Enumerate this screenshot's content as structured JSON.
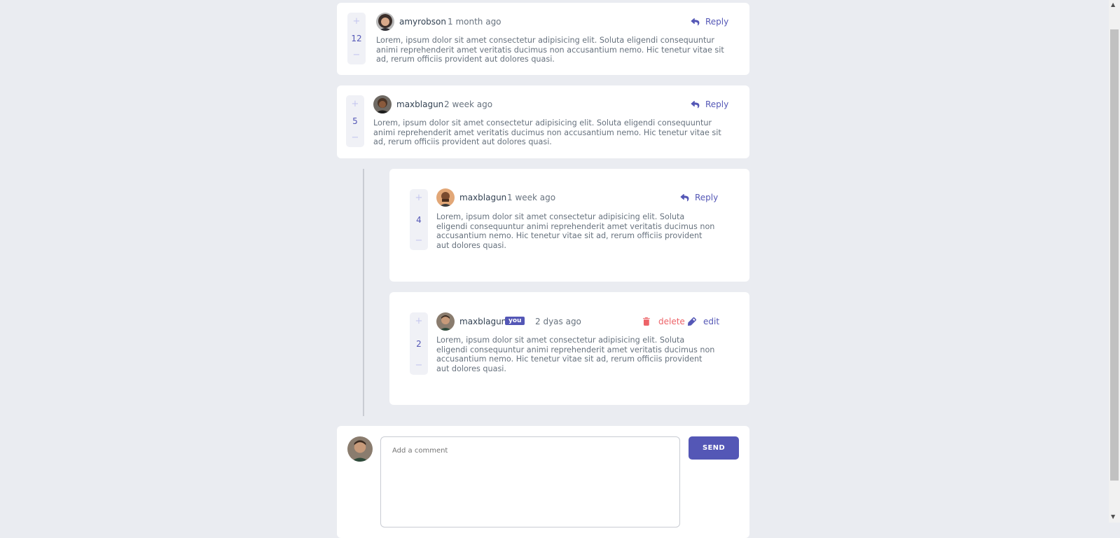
{
  "comments": [
    {
      "score": "12",
      "username": "amyrobson",
      "time": "1 month ago",
      "reply": "Reply",
      "text": "Lorem, ipsum dolor sit amet consectetur adipisicing elit. Soluta eligendi consequuntur animi reprehenderit amet veritatis ducimus non accusantium nemo. Hic tenetur vitae sit ad, rerum officiis provident aut dolores quasi."
    },
    {
      "score": "5",
      "username": "maxblagun",
      "time": "2 week ago",
      "reply": "Reply",
      "text": "Lorem, ipsum dolor sit amet consectetur adipisicing elit. Soluta eligendi consequuntur animi reprehenderit amet veritatis ducimus non accusantium nemo. Hic tenetur vitae sit ad, rerum officiis provident aut dolores quasi."
    },
    {
      "score": "4",
      "username": "maxblagun",
      "time": "1 week ago",
      "reply": "Reply",
      "text": "Lorem, ipsum dolor sit amet consectetur adipisicing elit. Soluta eligendi consequuntur animi reprehenderit amet veritatis ducimus non accusantium nemo. Hic tenetur vitae sit ad, rerum officiis provident aut dolores quasi."
    },
    {
      "score": "2",
      "username": "maxblagun",
      "badge": "you",
      "time": "2 dyas ago",
      "delete": "delete",
      "edit": "edit",
      "text": "Lorem, ipsum dolor sit amet consectetur adipisicing elit. Soluta eligendi consequuntur animi reprehenderit amet veritatis ducimus non accusantium nemo. Hic tenetur vitae sit ad, rerum officiis provident aut dolores quasi."
    }
  ],
  "vote": {
    "plus": "+",
    "minus": "−"
  },
  "composer": {
    "placeholder": "Add a comment",
    "send_label": "SEND"
  },
  "colors": {
    "accent": "#5457b6",
    "danger": "#ed6368",
    "background": "#eaecf1"
  },
  "icons": {
    "reply": "reply-icon",
    "delete": "trash-icon",
    "edit": "pencil-icon"
  }
}
